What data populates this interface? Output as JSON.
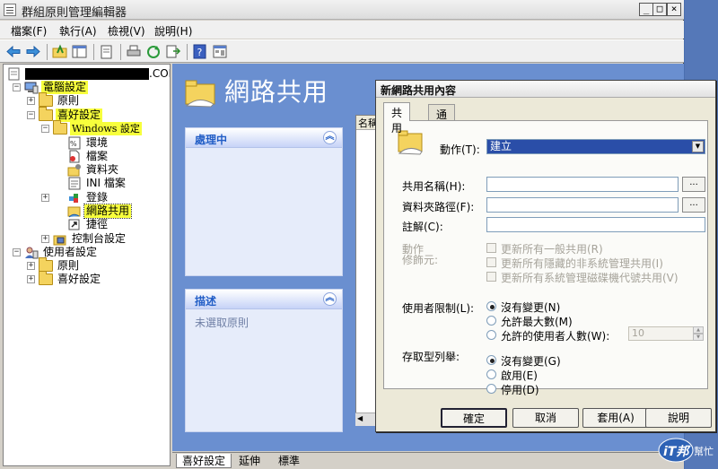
{
  "window": {
    "title": "群組原則管理編輯器",
    "controls": [
      "_",
      "□",
      "×"
    ]
  },
  "menu": [
    "檔案(F)",
    "執行(A)",
    "檢視(V)",
    "說明(H)"
  ],
  "tree": {
    "root_suffix": ".COM",
    "items": [
      {
        "label": "電腦設定",
        "pm": "−"
      },
      {
        "label": "原則",
        "pm": "+"
      },
      {
        "label": "喜好設定",
        "pm": "−"
      },
      {
        "label": "Windows 設定",
        "pm": "−"
      },
      {
        "label": "環境",
        "pm": ""
      },
      {
        "label": "檔案",
        "pm": ""
      },
      {
        "label": "資料夾",
        "pm": ""
      },
      {
        "label": "INI 檔案",
        "pm": ""
      },
      {
        "label": "登錄",
        "pm": "+"
      },
      {
        "label": "網路共用",
        "pm": ""
      },
      {
        "label": "捷徑",
        "pm": ""
      },
      {
        "label": "控制台設定",
        "pm": "+"
      },
      {
        "label": "使用者設定",
        "pm": "−"
      },
      {
        "label": "原則",
        "pm": "+"
      },
      {
        "label": "喜好設定",
        "pm": "+"
      }
    ]
  },
  "right": {
    "title": "網路共用",
    "panel_processing": "處理中",
    "panel_desc": "描述",
    "desc_text": "未選取原則",
    "column_header": "名稱"
  },
  "bottom_tabs": [
    "喜好設定",
    "延伸",
    "標準"
  ],
  "dialog": {
    "title": "新網路共用內容",
    "tabs": [
      "共用",
      "通用"
    ],
    "action_label": "動作(T):",
    "action_value": "建立",
    "share_name_label": "共用名稱(H):",
    "folder_path_label": "資料夾路徑(F):",
    "comment_label": "註解(C):",
    "browse": "...",
    "modifier_label_1": "動作",
    "modifier_label_2": "修飾元:",
    "modifiers": [
      "更新所有一般共用(R)",
      "更新所有隱藏的非系統管理共用(I)",
      "更新所有系統管理磁碟機代號共用(V)"
    ],
    "user_limit_label": "使用者限制(L):",
    "user_limit_options": [
      "沒有變更(N)",
      "允許最大數(M)",
      "允許的使用者人數(W):"
    ],
    "user_count_value": "10",
    "abe_label": "存取型列舉:",
    "abe_options": [
      "沒有變更(G)",
      "啟用(E)",
      "停用(D)"
    ],
    "buttons": [
      "確定",
      "取消",
      "套用(A)",
      "說明"
    ]
  },
  "logo": {
    "text": "iT邦",
    "sub": "幫忙"
  },
  "colors": {
    "accent": "#215dc6",
    "highlight": "#f7ff3c",
    "pane": "#6a8fd0"
  }
}
